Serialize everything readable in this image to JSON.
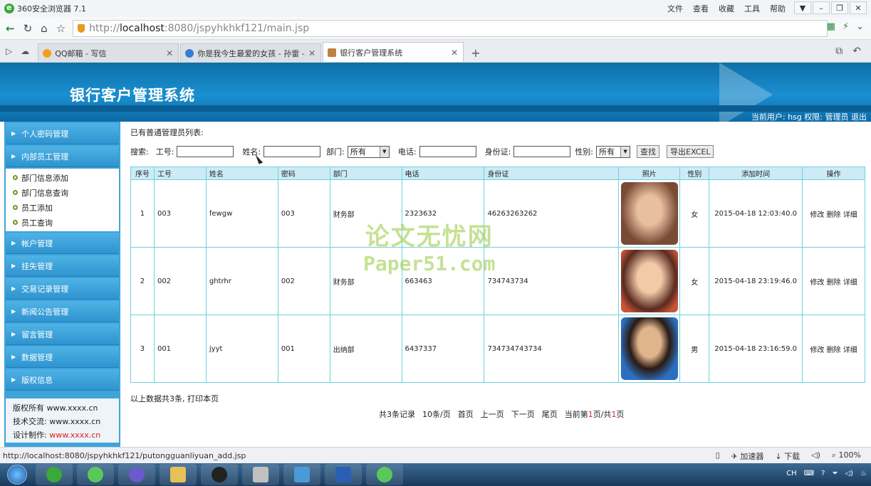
{
  "browser": {
    "title": "360安全浏览器 7.1",
    "menus": [
      "文件",
      "查看",
      "收藏",
      "工具",
      "帮助"
    ],
    "url_prefix": "http://",
    "url_host": "localhost",
    "url_rest": ":8080/jspyhkhkf121/main.jsp",
    "tabs": [
      {
        "label": "QQ邮箱 - 写信",
        "icon_color": "#f0a020"
      },
      {
        "label": "你是我今生最爱的女孩 - 孙雷 -",
        "icon_color": "#3a7bd5"
      },
      {
        "label": "银行客户管理系统",
        "icon_color": "#c08040"
      }
    ],
    "status_url": "http://localhost:8080/jspyhkhkf121/putongguanliyuan_add.jsp",
    "status_right": [
      "加速器",
      "下载",
      "100%"
    ]
  },
  "app": {
    "system_title": "银行客户管理系统",
    "current_user": "当前用户: hsg  权限: 管理员   退出",
    "sidebar": {
      "items_top": [
        "个人密码管理",
        "内部员工管理"
      ],
      "submenu": [
        "部门信息添加",
        "部门信息查询",
        "员工添加",
        "员工查询"
      ],
      "items_bottom": [
        "帐户管理",
        "挂失管理",
        "交易记录管理",
        "新闻公告管理",
        "留言管理",
        "数据管理",
        "版权信息"
      ],
      "footer": [
        {
          "label": "版权所有",
          "value": "www.xxxx.cn"
        },
        {
          "label": "技术交流:",
          "value": "www.xxxx.cn"
        },
        {
          "label": "设计制作:",
          "value": "www.xxxx.cn"
        }
      ]
    },
    "main": {
      "caption": "已有普通管理员列表:",
      "search": {
        "label": "搜索:",
        "id_label": "工号:",
        "name_label": "姓名:",
        "dept_label": "部门:",
        "dept_value": "所有",
        "phone_label": "电话:",
        "idcard_label": "身份证:",
        "gender_label": "性别:",
        "gender_value": "所有",
        "search_button": "查找",
        "export_button": "导出EXCEL"
      },
      "columns": [
        "序号",
        "工号",
        "姓名",
        "密码",
        "部门",
        "电话",
        "身份证",
        "照片",
        "性别",
        "添加时间",
        "操作"
      ],
      "rows": [
        {
          "no": "1",
          "id": "003",
          "name": "fewgw",
          "password": "003",
          "dept": "财务部",
          "phone": "2323632",
          "idcard": "46263263262",
          "photo_color": "#7a4a34",
          "gender": "女",
          "time": "2015-04-18 12:03:40.0",
          "ops": [
            "修改",
            "删除",
            "详细"
          ]
        },
        {
          "no": "2",
          "id": "002",
          "name": "ghtrhr",
          "password": "002",
          "dept": "财务部",
          "phone": "663463",
          "idcard": "734743734",
          "photo_color": "#c8553a",
          "gender": "女",
          "time": "2015-04-18 23:19:46.0",
          "ops": [
            "修改",
            "删除",
            "详细"
          ]
        },
        {
          "no": "3",
          "id": "001",
          "name": "jyyt",
          "password": "001",
          "dept": "出纳部",
          "phone": "6437337",
          "idcard": "734734743734",
          "photo_color": "#2c6fbf",
          "gender": "男",
          "time": "2015-04-18 23:16:59.0",
          "ops": [
            "修改",
            "删除",
            "详细"
          ]
        }
      ],
      "summary": "以上数据共3条, 打印本页",
      "pager": {
        "total": "共3条记录",
        "per_page": "10条/页",
        "first": "首页",
        "prev": "上一页",
        "next": "下一页",
        "last": "尾页",
        "page_prefix": "当前第",
        "page_current": "1",
        "page_mid": "页/共",
        "page_total": "1",
        "page_suffix": "页"
      }
    },
    "watermark": {
      "line1": "论文无忧网",
      "line2": "Paper51.com"
    }
  },
  "colors": {
    "accent": "#1a8fd0",
    "grid_border": "#6fd0e0",
    "link_red": "#e02020"
  }
}
